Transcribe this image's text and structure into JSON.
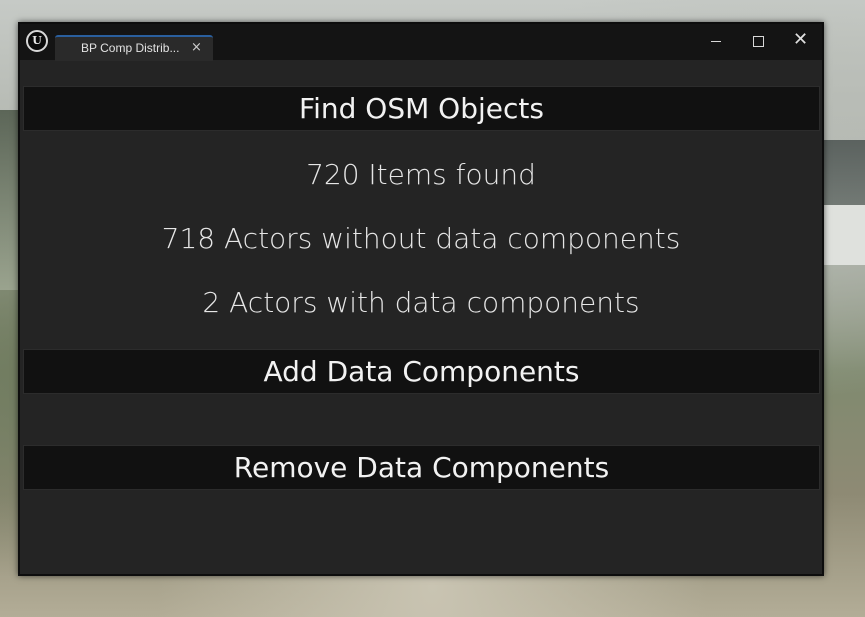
{
  "window": {
    "tab_title": "BP Comp Distrib...",
    "tab_close": "×",
    "logo_letter": "U",
    "icons": {
      "logo": "unreal-engine-logo",
      "minimize": "minimize-icon",
      "maximize": "maximize-icon",
      "close": "close-icon"
    },
    "close_glyph": "✕"
  },
  "content": {
    "find_button_label": "Find OSM Objects",
    "items_found": "720 Items found",
    "actors_without": "718 Actors without data components",
    "actors_with": "2 Actors with data components",
    "add_button_label": "Add Data Components",
    "remove_button_label": "Remove Data Components"
  },
  "colors": {
    "window_bg": "#242424",
    "titlebar_bg": "#141414",
    "button_bg": "#111111",
    "tab_accent": "#2a5f9e",
    "text": "#f2f2f2"
  }
}
